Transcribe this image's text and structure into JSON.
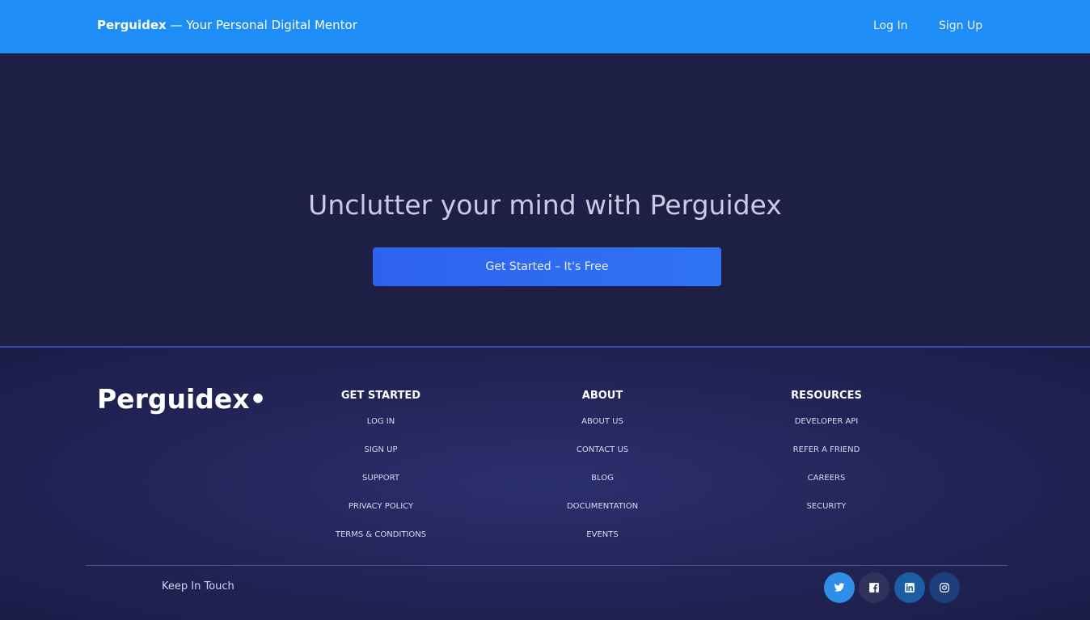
{
  "navbar": {
    "brand_name": "Perguidex",
    "tagline": " — Your Personal Digital Mentor",
    "login": "Log In",
    "signup": "Sign Up",
    "bg_color": "#1e8df6"
  },
  "hero": {
    "title": "Unclutter your mind with Perguidex",
    "cta_label": "Get Started – It's Free"
  },
  "footer": {
    "logo": "Perguidex•",
    "columns": [
      {
        "heading": "GET STARTED",
        "links": [
          "LOG IN",
          "SIGN UP",
          "SUPPORT",
          "PRIVACY POLICY",
          "TERMS & CONDITIONS"
        ]
      },
      {
        "heading": "ABOUT",
        "links": [
          "ABOUT US",
          "CONTACT US",
          "BLOG",
          "DOCUMENTATION",
          "EVENTS"
        ]
      },
      {
        "heading": "RESOURCES",
        "links": [
          "DEVELOPER API",
          "REFER A FRIEND",
          "CAREERS",
          "SECURITY"
        ]
      }
    ],
    "keep_in_touch": "Keep In Touch",
    "social_icons": [
      "twitter-icon",
      "facebook-icon",
      "linkedin-icon",
      "instagram-icon"
    ]
  }
}
